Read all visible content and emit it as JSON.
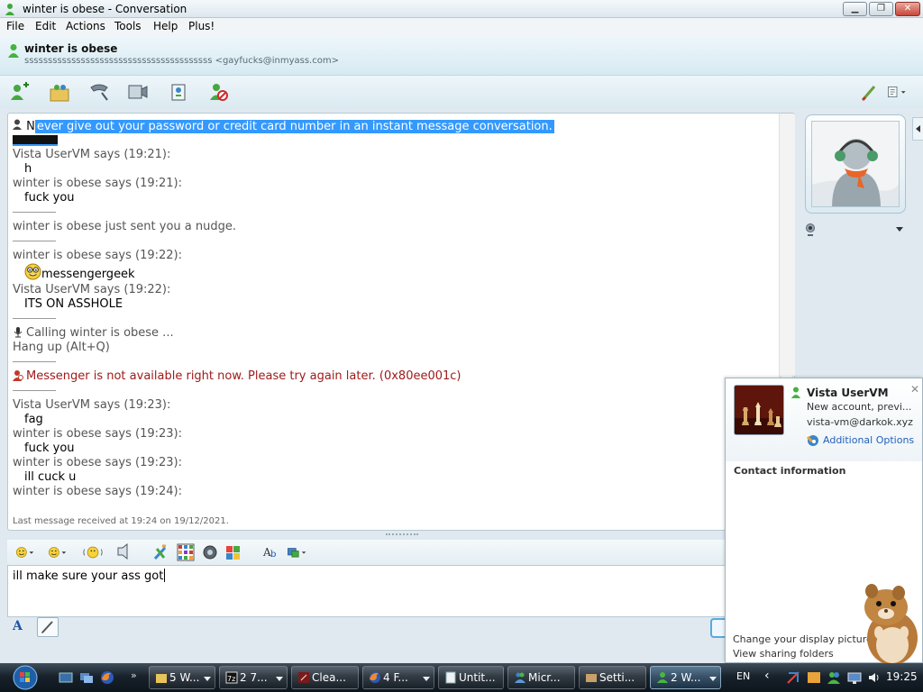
{
  "window": {
    "title": "winter is obese - Conversation",
    "controls": {
      "minimize": "▁",
      "maximize": "❐",
      "close": "✕"
    }
  },
  "menu": [
    "File",
    "Edit",
    "Actions",
    "Tools",
    "Help",
    "Plus!"
  ],
  "header": {
    "contact_name": "winter is obese",
    "contact_status": "online",
    "contact_sub": "ssssssssssssssssssssssssssssssssssssssss <gayfucks@inmyass.com>"
  },
  "toolbar": {
    "icons": [
      "invite-contact-icon",
      "share-files-icon",
      "call-icon",
      "video-call-icon",
      "games-icon",
      "block-icon",
      "backgrounds-icon",
      "show-menu-icon"
    ]
  },
  "conversation": {
    "warning_first_letter": "N",
    "warning_rest": "ever give out your password or credit card number in an instant message conversation.",
    "lines": [
      {
        "kind": "says",
        "text": "Vista UserVM says (19:21):"
      },
      {
        "kind": "msg",
        "text": "h"
      },
      {
        "kind": "says",
        "text": "winter is obese says (19:21):"
      },
      {
        "kind": "msg",
        "text": "fuck you"
      },
      {
        "kind": "sep"
      },
      {
        "kind": "sys",
        "text": "winter is obese just sent you a nudge."
      },
      {
        "kind": "sep"
      },
      {
        "kind": "says",
        "text": "winter is obese says (19:22):"
      },
      {
        "kind": "msg-emoticon",
        "text": "messengergeek"
      },
      {
        "kind": "says",
        "text": "Vista UserVM says (19:22):"
      },
      {
        "kind": "msg",
        "text": "ITS ON ASSHOLE"
      },
      {
        "kind": "sep"
      },
      {
        "kind": "sys-icon",
        "text": "Calling winter is obese ..."
      },
      {
        "kind": "sys",
        "text": "Hang up (Alt+Q)"
      },
      {
        "kind": "sep"
      },
      {
        "kind": "error",
        "text": "Messenger is not available right now. Please try again later. (0x80ee001c)"
      },
      {
        "kind": "sep"
      },
      {
        "kind": "says",
        "text": "Vista UserVM says (19:23):"
      },
      {
        "kind": "msg",
        "text": "fag"
      },
      {
        "kind": "says",
        "text": "winter is obese says (19:23):"
      },
      {
        "kind": "msg",
        "text": "fuck you"
      },
      {
        "kind": "says",
        "text": "winter is obese says (19:23):"
      },
      {
        "kind": "msg",
        "text": "ill cuck u"
      },
      {
        "kind": "says",
        "text": "winter is obese says (19:24):"
      }
    ],
    "last_received": "Last message received at 19:24 on 19/12/2021."
  },
  "format_toolbar": {
    "icons": [
      "emoticon-icon",
      "wink-icon",
      "nudge-icon",
      "voice-clip-icon",
      "backgrounds-icon",
      "games-grid-icon",
      "sound-icon",
      "winks-icon",
      "font-icon",
      "handwriting-icon"
    ]
  },
  "input": {
    "text": "ill make sure your ass got",
    "font_button": "A"
  },
  "contact_card": {
    "name": "Vista UserVM",
    "psm": "New account, previ...",
    "email": "vista-vm@darkok.xyz",
    "additional_options": "Additional Options",
    "contact_info_heading": "Contact information",
    "change_picture": "Change your display picture",
    "sharing_folders": "View sharing folders",
    "close": "✕"
  },
  "taskbar": {
    "tasks": [
      {
        "label": "5 W...",
        "icon": "folder-icon"
      },
      {
        "label": "2 7...",
        "icon": "7zip-icon"
      },
      {
        "label": "Clea...",
        "icon": "ccleaner-icon"
      },
      {
        "label": "4 F...",
        "icon": "firefox-icon"
      },
      {
        "label": "Untit...",
        "icon": "document-icon"
      },
      {
        "label": "Micr...",
        "icon": "messenger-icon"
      },
      {
        "label": "Setti...",
        "icon": "settings-icon"
      },
      {
        "label": "2 W...",
        "icon": "messenger-icon"
      }
    ],
    "more": "»",
    "language": "EN",
    "tray_chevron": "‹",
    "clock": "19:25"
  },
  "colors": {
    "selection": "#3399ff",
    "error_red": "#a01a1a",
    "link_blue": "#2360b8"
  }
}
